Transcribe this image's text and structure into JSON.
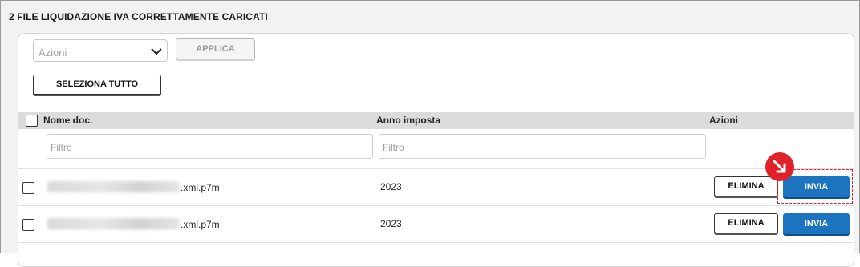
{
  "section": {
    "title": "2 FILE LIQUIDAZIONE IVA CORRETTAMENTE CARICATI"
  },
  "toolbar": {
    "actions_select": {
      "value": "Azioni"
    },
    "apply_label": "APPLICA",
    "select_all_label": "SELEZIONA TUTTO"
  },
  "table": {
    "headers": {
      "name": "Nome doc.",
      "year": "Anno imposta",
      "actions": "Azioni"
    },
    "filters": {
      "name_placeholder": "Filtro",
      "year_placeholder": "Filtro"
    },
    "rows": [
      {
        "file_suffix": ".xml.p7m",
        "year": "2023",
        "delete_label": "ELIMINA",
        "send_label": "INVIA"
      },
      {
        "file_suffix": ".xml.p7m",
        "year": "2023",
        "delete_label": "ELIMINA",
        "send_label": "INVIA"
      }
    ]
  },
  "icons": {
    "dropdown": "chevron-down-icon",
    "marker": "arrow-down-right-icon"
  },
  "colors": {
    "primary_button": "#1c74c0",
    "highlight": "#d9232e",
    "header_bg": "#dcdcdc"
  }
}
